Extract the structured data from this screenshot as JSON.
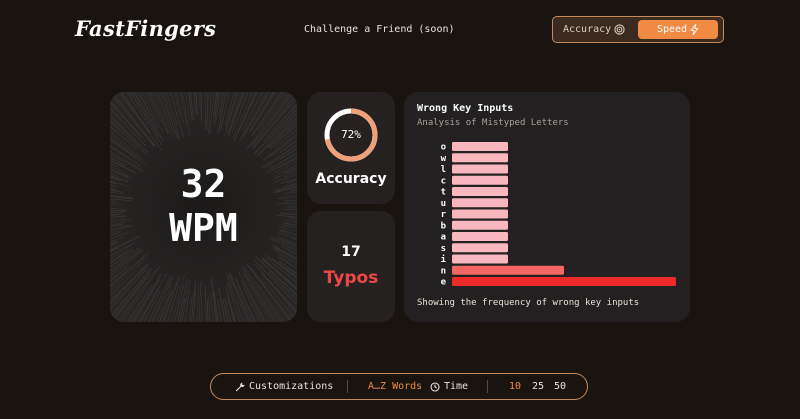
{
  "header": {
    "logo": "FastFingers",
    "challenge": "Challenge a Friend (soon)",
    "mode_accuracy": "Accuracy",
    "mode_speed": "Speed"
  },
  "stats": {
    "wpm_value": "32",
    "wpm_unit": "WPM",
    "accuracy_pct": "72%",
    "accuracy_fraction": 0.72,
    "accuracy_label": "Accuracy",
    "typos_value": "17",
    "typos_label": "Typos"
  },
  "chart_data": {
    "type": "bar",
    "orientation": "horizontal",
    "title": "Wrong Key Inputs",
    "subtitle": "Analysis of Mistyped Letters",
    "footer": "Showing the frequency of wrong key inputs",
    "categories": [
      "o",
      "w",
      "l",
      "c",
      "t",
      "u",
      "r",
      "b",
      "a",
      "s",
      "i",
      "n",
      "e"
    ],
    "values": [
      1,
      1,
      1,
      1,
      1,
      1,
      1,
      1,
      1,
      1,
      1,
      2,
      4
    ],
    "xlim": [
      0,
      4
    ],
    "grid": false,
    "colors": {
      "low": "#f8b7bf",
      "mid": "#f26763",
      "high": "#ef2a2a"
    }
  },
  "footer_bar": {
    "customizations": "Customizations",
    "words": "A…Z Words",
    "time": "Time",
    "options": [
      "10",
      "25",
      "50"
    ]
  }
}
